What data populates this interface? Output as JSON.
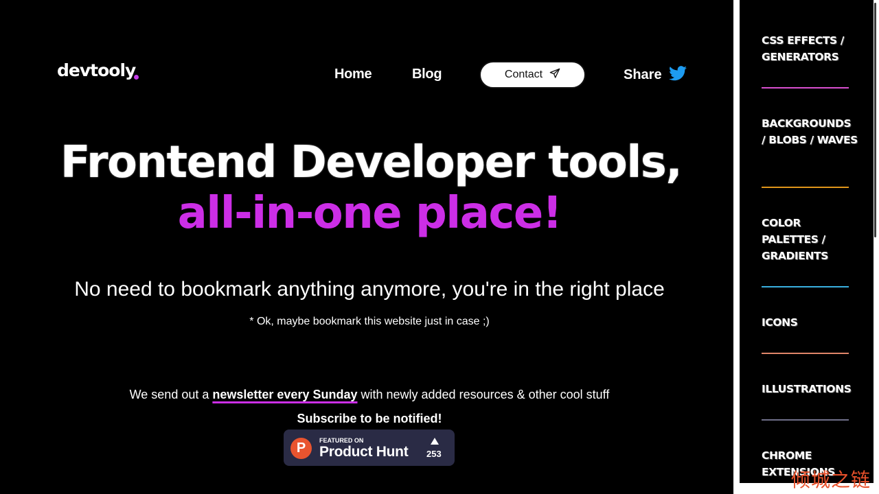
{
  "brand": {
    "logo_text": "devtooly",
    "accent_color": "#cc2ee6"
  },
  "nav": {
    "home": "Home",
    "blog": "Blog",
    "contact": "Contact",
    "share": "Share",
    "twitter_color": "#1d9bf0"
  },
  "hero": {
    "line1": "Frontend Developer tools,",
    "line2": "all-in-one place!",
    "subtitle": "No need to bookmark anything anymore, you're in the right place",
    "note": "* Ok, maybe bookmark this website just in case ;)"
  },
  "newsletter": {
    "prefix": "We send out a ",
    "link": "newsletter every Sunday",
    "suffix": " with newly added resources & other cool stuff",
    "subscribe": "Subscribe to be notified!"
  },
  "product_hunt": {
    "logo_letter": "P",
    "featured": "FEATURED ON",
    "name": "Product Hunt",
    "upvotes": "253"
  },
  "sidebar": {
    "categories": [
      {
        "label": "CSS EFFECTS / GENERATORS",
        "color": "#d94fd0"
      },
      {
        "label": "BACKGROUNDS / BLOBS / WAVES",
        "color": "#e0961a"
      },
      {
        "label": "COLOR PALETTES / GRADIENTS",
        "color": "#3ab0e0"
      },
      {
        "label": "ICONS",
        "color": "#e0866a"
      },
      {
        "label": "ILLUSTRATIONS",
        "color": "#6f6f8a"
      },
      {
        "label": "CHROME EXTENSIONS"
      }
    ]
  },
  "watermark": "倾城之链"
}
